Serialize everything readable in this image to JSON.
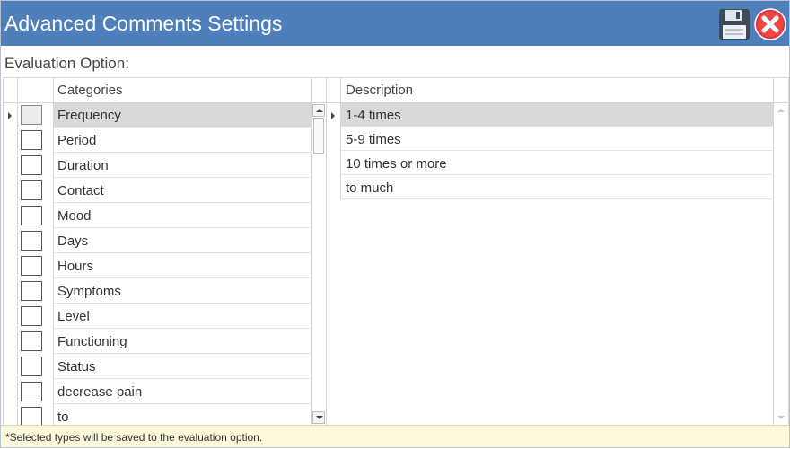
{
  "window": {
    "title": "Advanced Comments Settings"
  },
  "colors": {
    "titlebar": "#4f7fba",
    "selected_row": "#d9d9d9",
    "footer_bg": "#fbf8dc"
  },
  "toolbar": {
    "save_icon": "floppy-disk-icon",
    "close_icon": "red-circle-x-icon"
  },
  "evaluation_label": "Evaluation Option:",
  "categories_grid": {
    "header": "Categories",
    "rows": [
      {
        "label": "Frequency",
        "selected": true
      },
      {
        "label": "Period"
      },
      {
        "label": "Duration"
      },
      {
        "label": "Contact"
      },
      {
        "label": "Mood"
      },
      {
        "label": "Days"
      },
      {
        "label": "Hours"
      },
      {
        "label": "Symptoms"
      },
      {
        "label": "Level"
      },
      {
        "label": "Functioning"
      },
      {
        "label": "Status"
      },
      {
        "label": "decrease pain"
      },
      {
        "label": "to"
      }
    ]
  },
  "description_grid": {
    "header": "Description",
    "rows": [
      {
        "label": "1-4 times",
        "selected": true
      },
      {
        "label": "5-9 times"
      },
      {
        "label": "10 times or more"
      },
      {
        "label": "to much"
      }
    ]
  },
  "footer": {
    "note": "*Selected types will be saved to the evaluation option."
  }
}
